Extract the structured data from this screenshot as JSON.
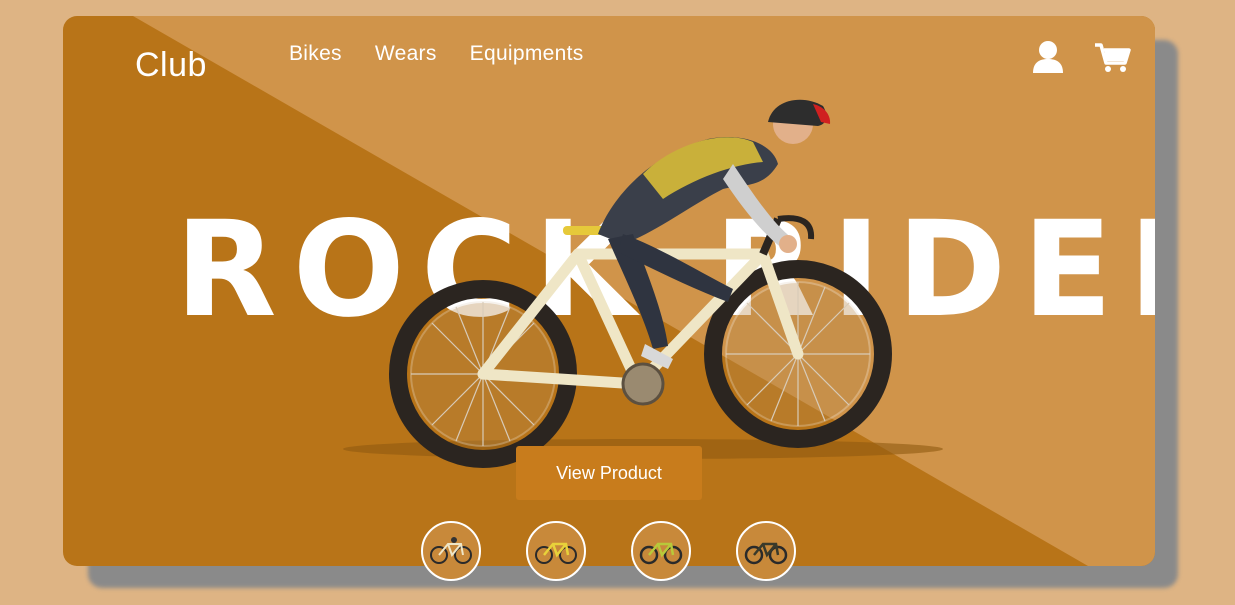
{
  "header": {
    "logo": "Club",
    "nav": [
      "Bikes",
      "Wears",
      "Equipments"
    ],
    "icons": [
      "user-icon",
      "cart-icon"
    ]
  },
  "hero": {
    "headline": "ROCK RIDER",
    "button_label": "View Product"
  },
  "thumbnails": [
    "bike-thumb-1",
    "bike-thumb-2",
    "bike-thumb-3",
    "bike-thumb-4"
  ],
  "colors": {
    "page_background": "#deb484",
    "card_dark": "#b87418",
    "card_light": "#d0944a",
    "button": "#c87c1c"
  }
}
